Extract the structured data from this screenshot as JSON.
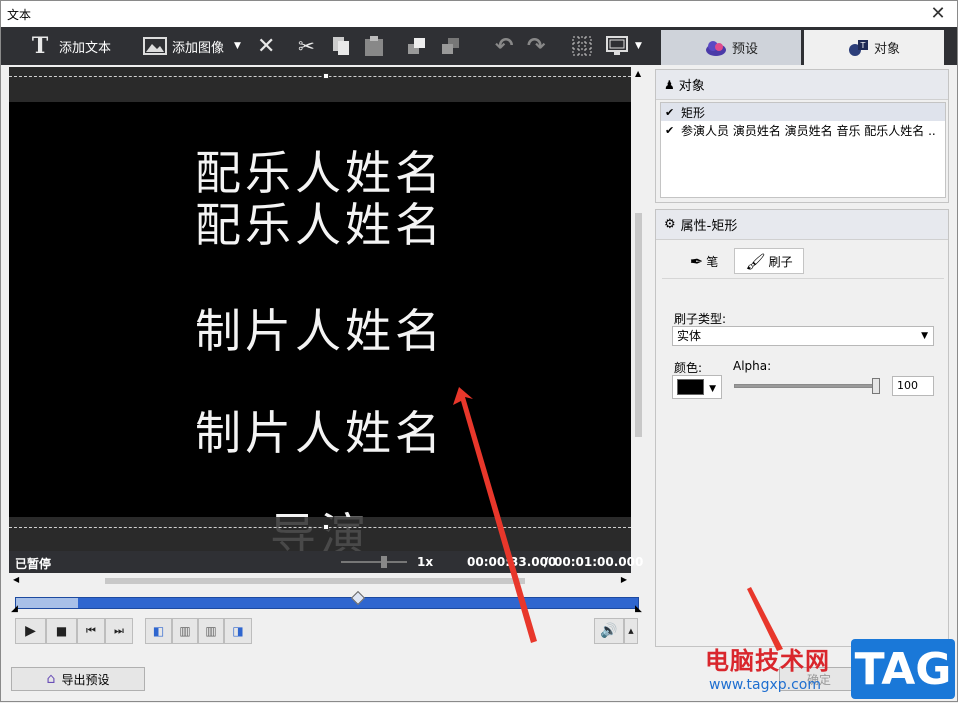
{
  "window": {
    "title": "文本",
    "close": "✕"
  },
  "toolbar": {
    "add_text": "添加文本",
    "add_image": "添加图像"
  },
  "tabs": {
    "preset": "预设",
    "object": "对象"
  },
  "preview": {
    "credits": [
      "配乐人姓名",
      "配乐人姓名",
      "制片人姓名",
      "制片人姓名",
      "导演"
    ]
  },
  "status": {
    "state": "已暂停",
    "speed": "1x",
    "current_time": "00:00:33.000",
    "separator": "/",
    "total_time": "00:01:00.000",
    "playhead_fraction": 0.55
  },
  "objects_panel": {
    "title": "对象",
    "items": [
      {
        "label": "矩形",
        "checked": true,
        "selected": true
      },
      {
        "label": "参演人员 演员姓名 演员姓名 音乐 配乐人姓名 ..",
        "checked": true,
        "selected": false
      }
    ]
  },
  "props_panel": {
    "title": "属性-矩形",
    "tab_pen": "笔",
    "tab_brush": "刷子",
    "brush_type_label": "刷子类型:",
    "brush_type_value": "实体",
    "color_label": "颜色:",
    "color_value": "#000000",
    "alpha_label": "Alpha:",
    "alpha_value": "100"
  },
  "footer": {
    "export_preset": "导出预设",
    "ok": "确定"
  },
  "watermark": {
    "site_name": "电脑技术网",
    "url": "www.tagxp.com",
    "badge": "TAG"
  }
}
